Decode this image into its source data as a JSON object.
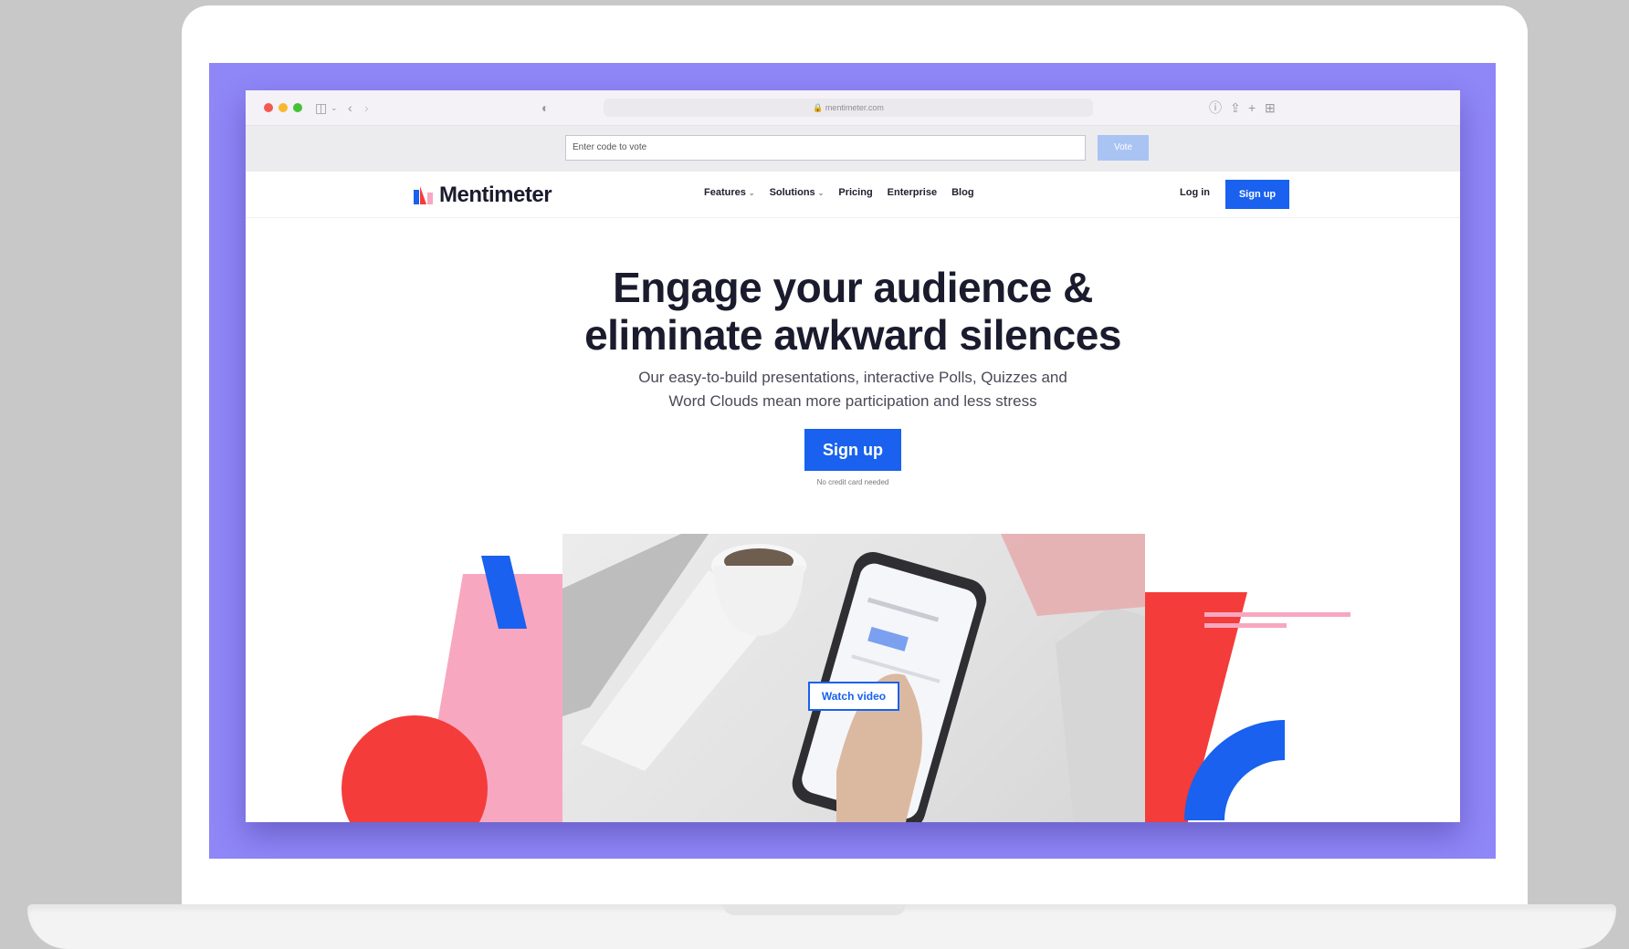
{
  "colors": {
    "background": "#c8c8c8",
    "screen": "#8f86f7",
    "brand_blue": "#1961ee",
    "accent_red": "#f43c3a",
    "accent_pink": "#f8a7c0"
  },
  "browser": {
    "url": "mentimeter.com",
    "icons": [
      "sidebar-icon",
      "back-icon",
      "forward-icon",
      "shield-icon",
      "info-icon",
      "share-icon",
      "new-tab-icon",
      "tabs-grid-icon"
    ]
  },
  "vote_bar": {
    "placeholder": "Enter code to vote",
    "button_label": "Vote"
  },
  "nav": {
    "logo_text": "Mentimeter",
    "links": [
      "Features",
      "Solutions",
      "Pricing",
      "Enterprise",
      "Blog"
    ],
    "login_label": "Log in",
    "signup_label": "Sign up"
  },
  "hero": {
    "title": "Engage your audience &\neliminate awkward silences",
    "subtitle": "Our easy-to-build presentations, interactive Polls, Quizzes and\nWord Clouds mean more participation and less stress",
    "signup_label": "Sign up",
    "note": "No credit card needed",
    "watch_video_label": "Watch video"
  }
}
